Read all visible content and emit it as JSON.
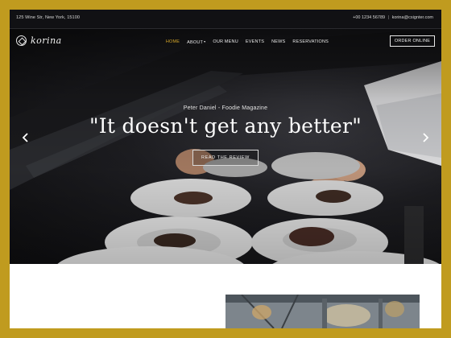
{
  "topbar": {
    "address": "125 Wine Str, New York, 15100",
    "phone": "+00 1234 56789",
    "separator": "|",
    "email": "korina@csignter.com"
  },
  "brand": {
    "name": "korina",
    "icon": "logo-diamond-icon"
  },
  "nav": {
    "items": [
      {
        "label": "HOME",
        "active": true
      },
      {
        "label": "ABOUT",
        "dropdown": true
      },
      {
        "label": "OUR MENU"
      },
      {
        "label": "EVENTS"
      },
      {
        "label": "NEWS"
      },
      {
        "label": "RESERVATIONS"
      }
    ],
    "caret": "▾",
    "order_button": "ORDER ONLINE"
  },
  "hero": {
    "caption": "Peter Daniel - Foodie Magazine",
    "title": "\"It doesn't get any better\"",
    "button": "READ THE REVIEW",
    "prev_icon": "chevron-left-icon",
    "next_icon": "chevron-right-icon"
  },
  "colors": {
    "frame_gold": "#c09b1f",
    "accent": "#d4a62a",
    "topbar_bg": "#111114",
    "text_light": "#e8e8e8"
  }
}
